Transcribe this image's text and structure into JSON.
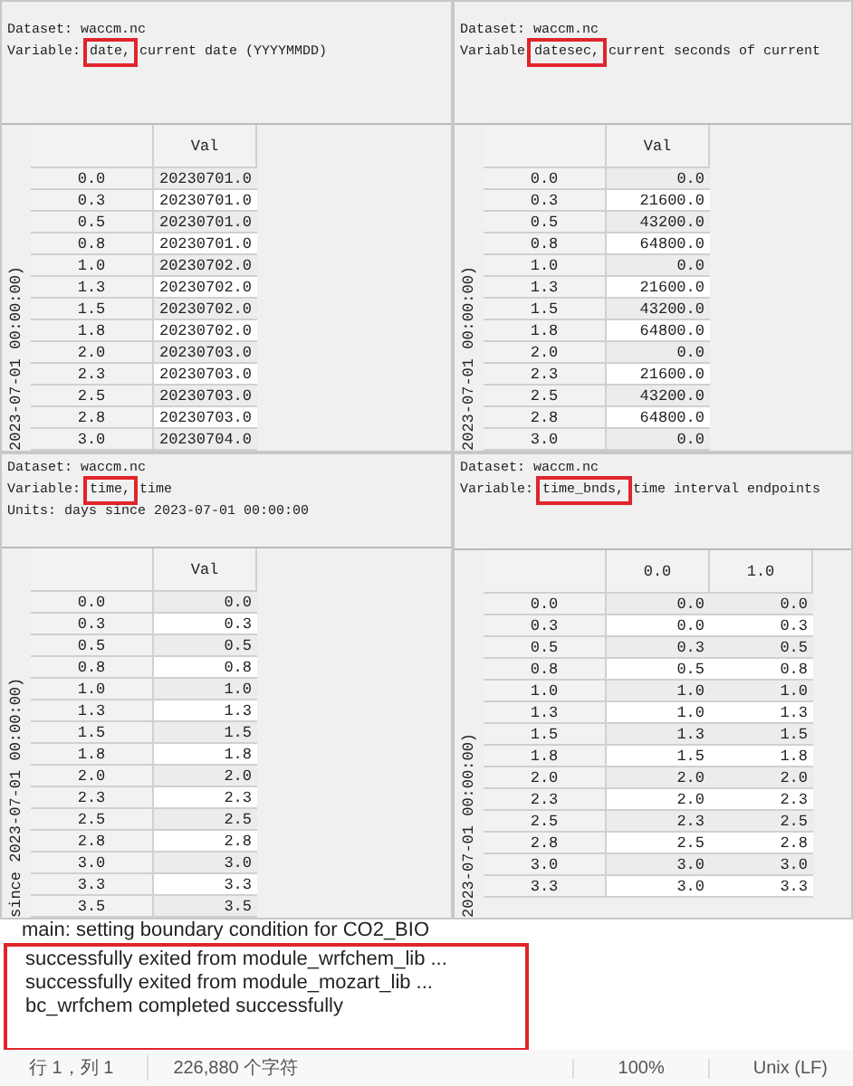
{
  "panels": [
    {
      "dataset": "Dataset: waccm.nc",
      "variable_prefix": "Variable:",
      "variable": "date,",
      "description": "current date (YYYYMMDD)",
      "axis_label": "2023-07-01 00:00:00)",
      "columns": [
        "Val"
      ],
      "rows": [
        {
          "index": "0.0",
          "cells": [
            "20230701.0"
          ]
        },
        {
          "index": "0.3",
          "cells": [
            "20230701.0"
          ]
        },
        {
          "index": "0.5",
          "cells": [
            "20230701.0"
          ]
        },
        {
          "index": "0.8",
          "cells": [
            "20230701.0"
          ]
        },
        {
          "index": "1.0",
          "cells": [
            "20230702.0"
          ]
        },
        {
          "index": "1.3",
          "cells": [
            "20230702.0"
          ]
        },
        {
          "index": "1.5",
          "cells": [
            "20230702.0"
          ]
        },
        {
          "index": "1.8",
          "cells": [
            "20230702.0"
          ]
        },
        {
          "index": "2.0",
          "cells": [
            "20230703.0"
          ]
        },
        {
          "index": "2.3",
          "cells": [
            "20230703.0"
          ]
        },
        {
          "index": "2.5",
          "cells": [
            "20230703.0"
          ]
        },
        {
          "index": "2.8",
          "cells": [
            "20230703.0"
          ]
        },
        {
          "index": "3.0",
          "cells": [
            "20230704.0"
          ]
        }
      ]
    },
    {
      "dataset": "Dataset: waccm.nc",
      "variable_prefix": "Variable",
      "variable": "datesec,",
      "description": "current seconds of current",
      "axis_label": "2023-07-01 00:00:00)",
      "columns": [
        "Val"
      ],
      "rows": [
        {
          "index": "0.0",
          "cells": [
            "0.0"
          ]
        },
        {
          "index": "0.3",
          "cells": [
            "21600.0"
          ]
        },
        {
          "index": "0.5",
          "cells": [
            "43200.0"
          ]
        },
        {
          "index": "0.8",
          "cells": [
            "64800.0"
          ]
        },
        {
          "index": "1.0",
          "cells": [
            "0.0"
          ]
        },
        {
          "index": "1.3",
          "cells": [
            "21600.0"
          ]
        },
        {
          "index": "1.5",
          "cells": [
            "43200.0"
          ]
        },
        {
          "index": "1.8",
          "cells": [
            "64800.0"
          ]
        },
        {
          "index": "2.0",
          "cells": [
            "0.0"
          ]
        },
        {
          "index": "2.3",
          "cells": [
            "21600.0"
          ]
        },
        {
          "index": "2.5",
          "cells": [
            "43200.0"
          ]
        },
        {
          "index": "2.8",
          "cells": [
            "64800.0"
          ]
        },
        {
          "index": "3.0",
          "cells": [
            "0.0"
          ]
        }
      ]
    },
    {
      "dataset": "Dataset: waccm.nc",
      "variable_prefix": "Variable:",
      "variable": "time,",
      "description": "time",
      "units": "Units: days since 2023-07-01 00:00:00",
      "axis_label": "since 2023-07-01 00:00:00)",
      "columns": [
        "Val"
      ],
      "rows": [
        {
          "index": "0.0",
          "cells": [
            "0.0"
          ]
        },
        {
          "index": "0.3",
          "cells": [
            "0.3"
          ]
        },
        {
          "index": "0.5",
          "cells": [
            "0.5"
          ]
        },
        {
          "index": "0.8",
          "cells": [
            "0.8"
          ]
        },
        {
          "index": "1.0",
          "cells": [
            "1.0"
          ]
        },
        {
          "index": "1.3",
          "cells": [
            "1.3"
          ]
        },
        {
          "index": "1.5",
          "cells": [
            "1.5"
          ]
        },
        {
          "index": "1.8",
          "cells": [
            "1.8"
          ]
        },
        {
          "index": "2.0",
          "cells": [
            "2.0"
          ]
        },
        {
          "index": "2.3",
          "cells": [
            "2.3"
          ]
        },
        {
          "index": "2.5",
          "cells": [
            "2.5"
          ]
        },
        {
          "index": "2.8",
          "cells": [
            "2.8"
          ]
        },
        {
          "index": "3.0",
          "cells": [
            "3.0"
          ]
        },
        {
          "index": "3.3",
          "cells": [
            "3.3"
          ]
        },
        {
          "index": "3.5",
          "cells": [
            "3.5"
          ]
        }
      ]
    },
    {
      "dataset": "Dataset: waccm.nc",
      "variable_prefix": "Variable:",
      "variable": "time_bnds,",
      "description": "time interval endpoints",
      "axis_label": "2023-07-01 00:00:00)",
      "columns": [
        "0.0",
        "1.0"
      ],
      "rows": [
        {
          "index": "0.0",
          "cells": [
            "0.0",
            "0.0"
          ]
        },
        {
          "index": "0.3",
          "cells": [
            "0.0",
            "0.3"
          ]
        },
        {
          "index": "0.5",
          "cells": [
            "0.3",
            "0.5"
          ]
        },
        {
          "index": "0.8",
          "cells": [
            "0.5",
            "0.8"
          ]
        },
        {
          "index": "1.0",
          "cells": [
            "1.0",
            "1.0"
          ]
        },
        {
          "index": "1.3",
          "cells": [
            "1.0",
            "1.3"
          ]
        },
        {
          "index": "1.5",
          "cells": [
            "1.3",
            "1.5"
          ]
        },
        {
          "index": "1.8",
          "cells": [
            "1.5",
            "1.8"
          ]
        },
        {
          "index": "2.0",
          "cells": [
            "2.0",
            "2.0"
          ]
        },
        {
          "index": "2.3",
          "cells": [
            "2.0",
            "2.3"
          ]
        },
        {
          "index": "2.5",
          "cells": [
            "2.3",
            "2.5"
          ]
        },
        {
          "index": "2.8",
          "cells": [
            "2.5",
            "2.8"
          ]
        },
        {
          "index": "3.0",
          "cells": [
            "3.0",
            "3.0"
          ]
        },
        {
          "index": "3.3",
          "cells": [
            "3.0",
            "3.3"
          ]
        }
      ]
    }
  ],
  "log": {
    "lines": [
      "main: setting boundary condition for CO2_BIO"
    ],
    "highlighted_lines": [
      "successfully exited from module_wrfchem_lib ...",
      "successfully exited from module_mozart_lib ...",
      "bc_wrfchem completed successfully"
    ]
  },
  "status_bar": {
    "position": "行 1，列 1",
    "characters": "226,880 个字符",
    "zoom": "100%",
    "line_ending": "Unix (LF)"
  }
}
